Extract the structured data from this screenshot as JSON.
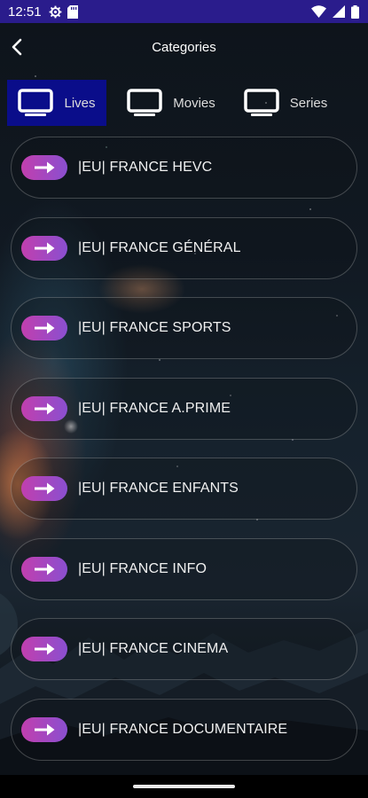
{
  "status_bar": {
    "time": "12:51",
    "bg_color": "#2a1c8c"
  },
  "header": {
    "title": "Categories"
  },
  "tabs": [
    {
      "label": "Lives",
      "icon": "tv-icon",
      "active": true
    },
    {
      "label": "Movies",
      "icon": "tv-icon",
      "active": false
    },
    {
      "label": "Series",
      "icon": "tv-icon",
      "active": false
    }
  ],
  "categories": [
    {
      "label": "|EU| FRANCE HEVC"
    },
    {
      "label": "|EU| FRANCE GÉNÉRAL"
    },
    {
      "label": "|EU| FRANCE SPORTS"
    },
    {
      "label": "|EU| FRANCE A.PRIME"
    },
    {
      "label": "|EU| FRANCE ENFANTS"
    },
    {
      "label": "|EU| FRANCE INFO"
    },
    {
      "label": "|EU| FRANCE CINEMA"
    },
    {
      "label": "|EU| FRANCE DOCUMENTAIRE"
    }
  ],
  "colors": {
    "active_tab": "#0a0d8a",
    "arrow_gradient_start": "#c13fae",
    "arrow_gradient_end": "#8a4fd0"
  }
}
